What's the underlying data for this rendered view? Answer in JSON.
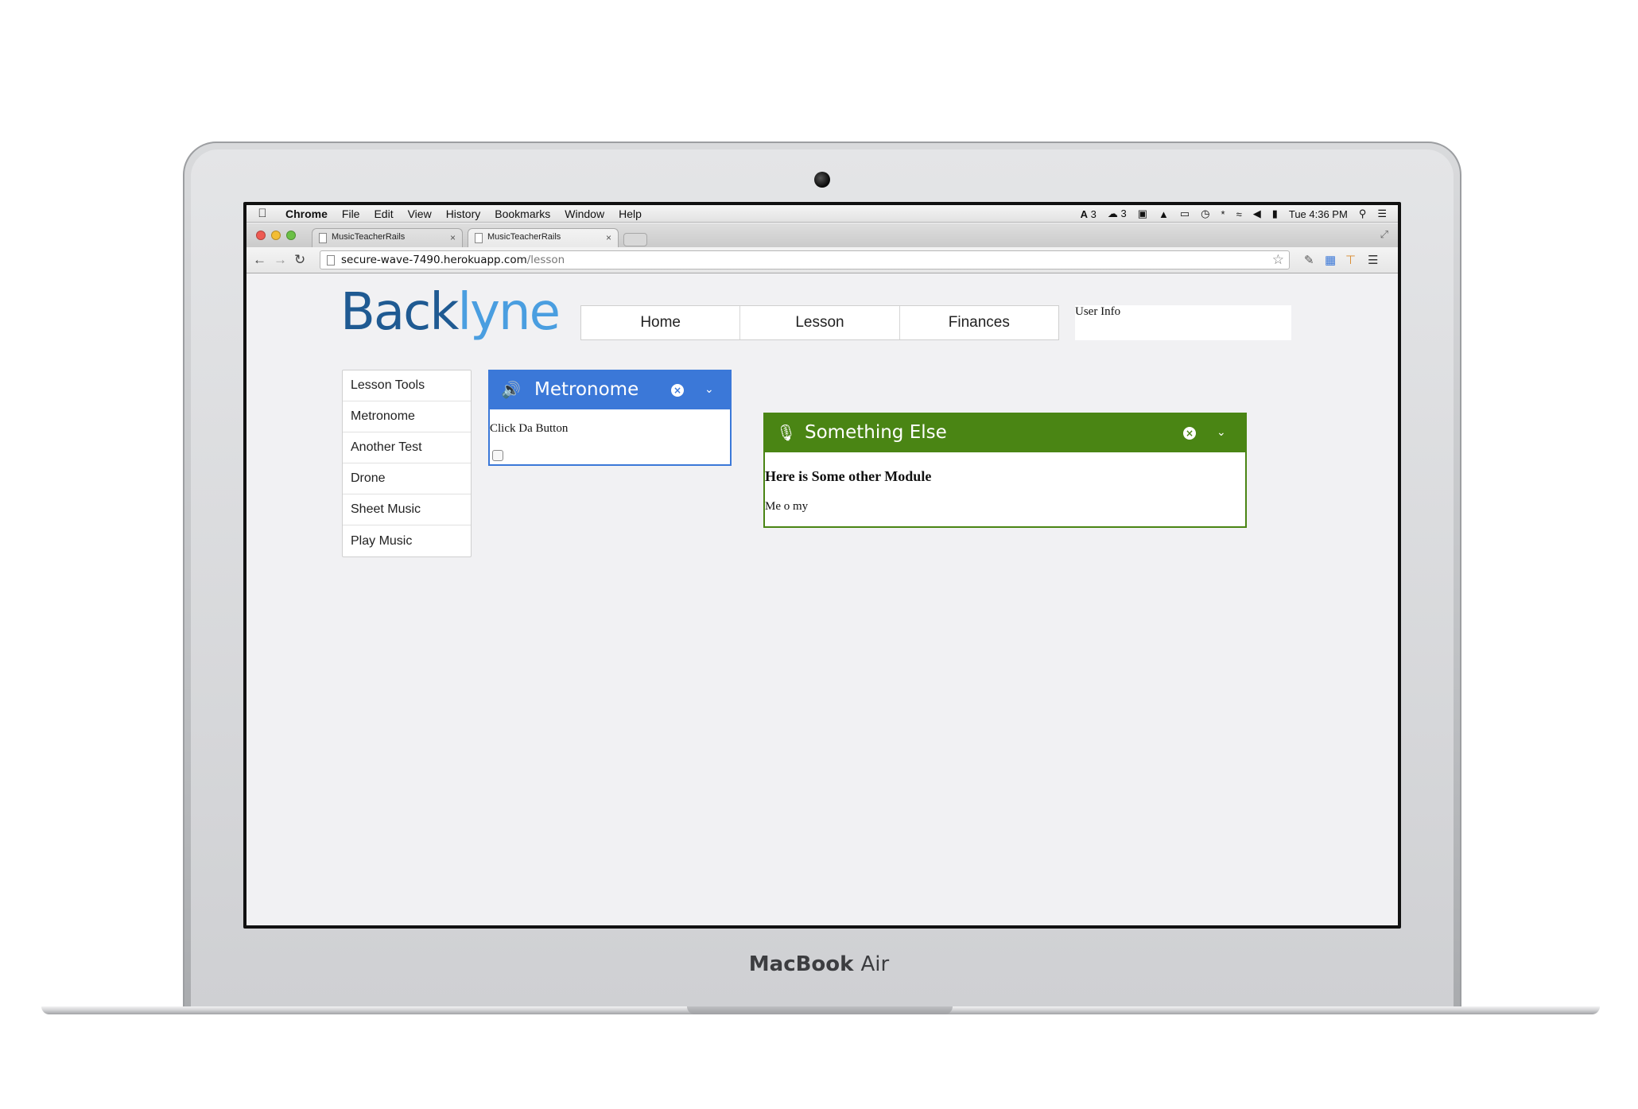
{
  "device": {
    "brand_bold": "MacBook",
    "brand_thin": "Air"
  },
  "menubar": {
    "app": "Chrome",
    "items": [
      "File",
      "Edit",
      "View",
      "History",
      "Bookmarks",
      "Window",
      "Help"
    ],
    "status": {
      "adobe_count": "3",
      "cloud_count": "3",
      "clock": "Tue 4:36 PM"
    }
  },
  "browser": {
    "tabs": [
      {
        "title": "MusicTeacherRails",
        "active": false
      },
      {
        "title": "MusicTeacherRails",
        "active": true
      }
    ],
    "url_host": "secure-wave-7490.herokuapp.com",
    "url_path": "/lesson"
  },
  "site": {
    "logo_dark": "Back",
    "logo_light": "lyne",
    "nav": [
      "Home",
      "Lesson",
      "Finances"
    ],
    "user_info": "User Info",
    "tools": [
      "Lesson Tools",
      "Metronome",
      "Another Test",
      "Drone",
      "Sheet Music",
      "Play Music"
    ],
    "modules": {
      "metronome": {
        "title": "Metronome",
        "body": "Click Da Button",
        "checkbox_checked": false,
        "color": "#3b78d8"
      },
      "something_else": {
        "title": "Something Else",
        "heading": "Here is Some other Module",
        "body": "Me o my",
        "color": "#4a8514"
      }
    }
  }
}
